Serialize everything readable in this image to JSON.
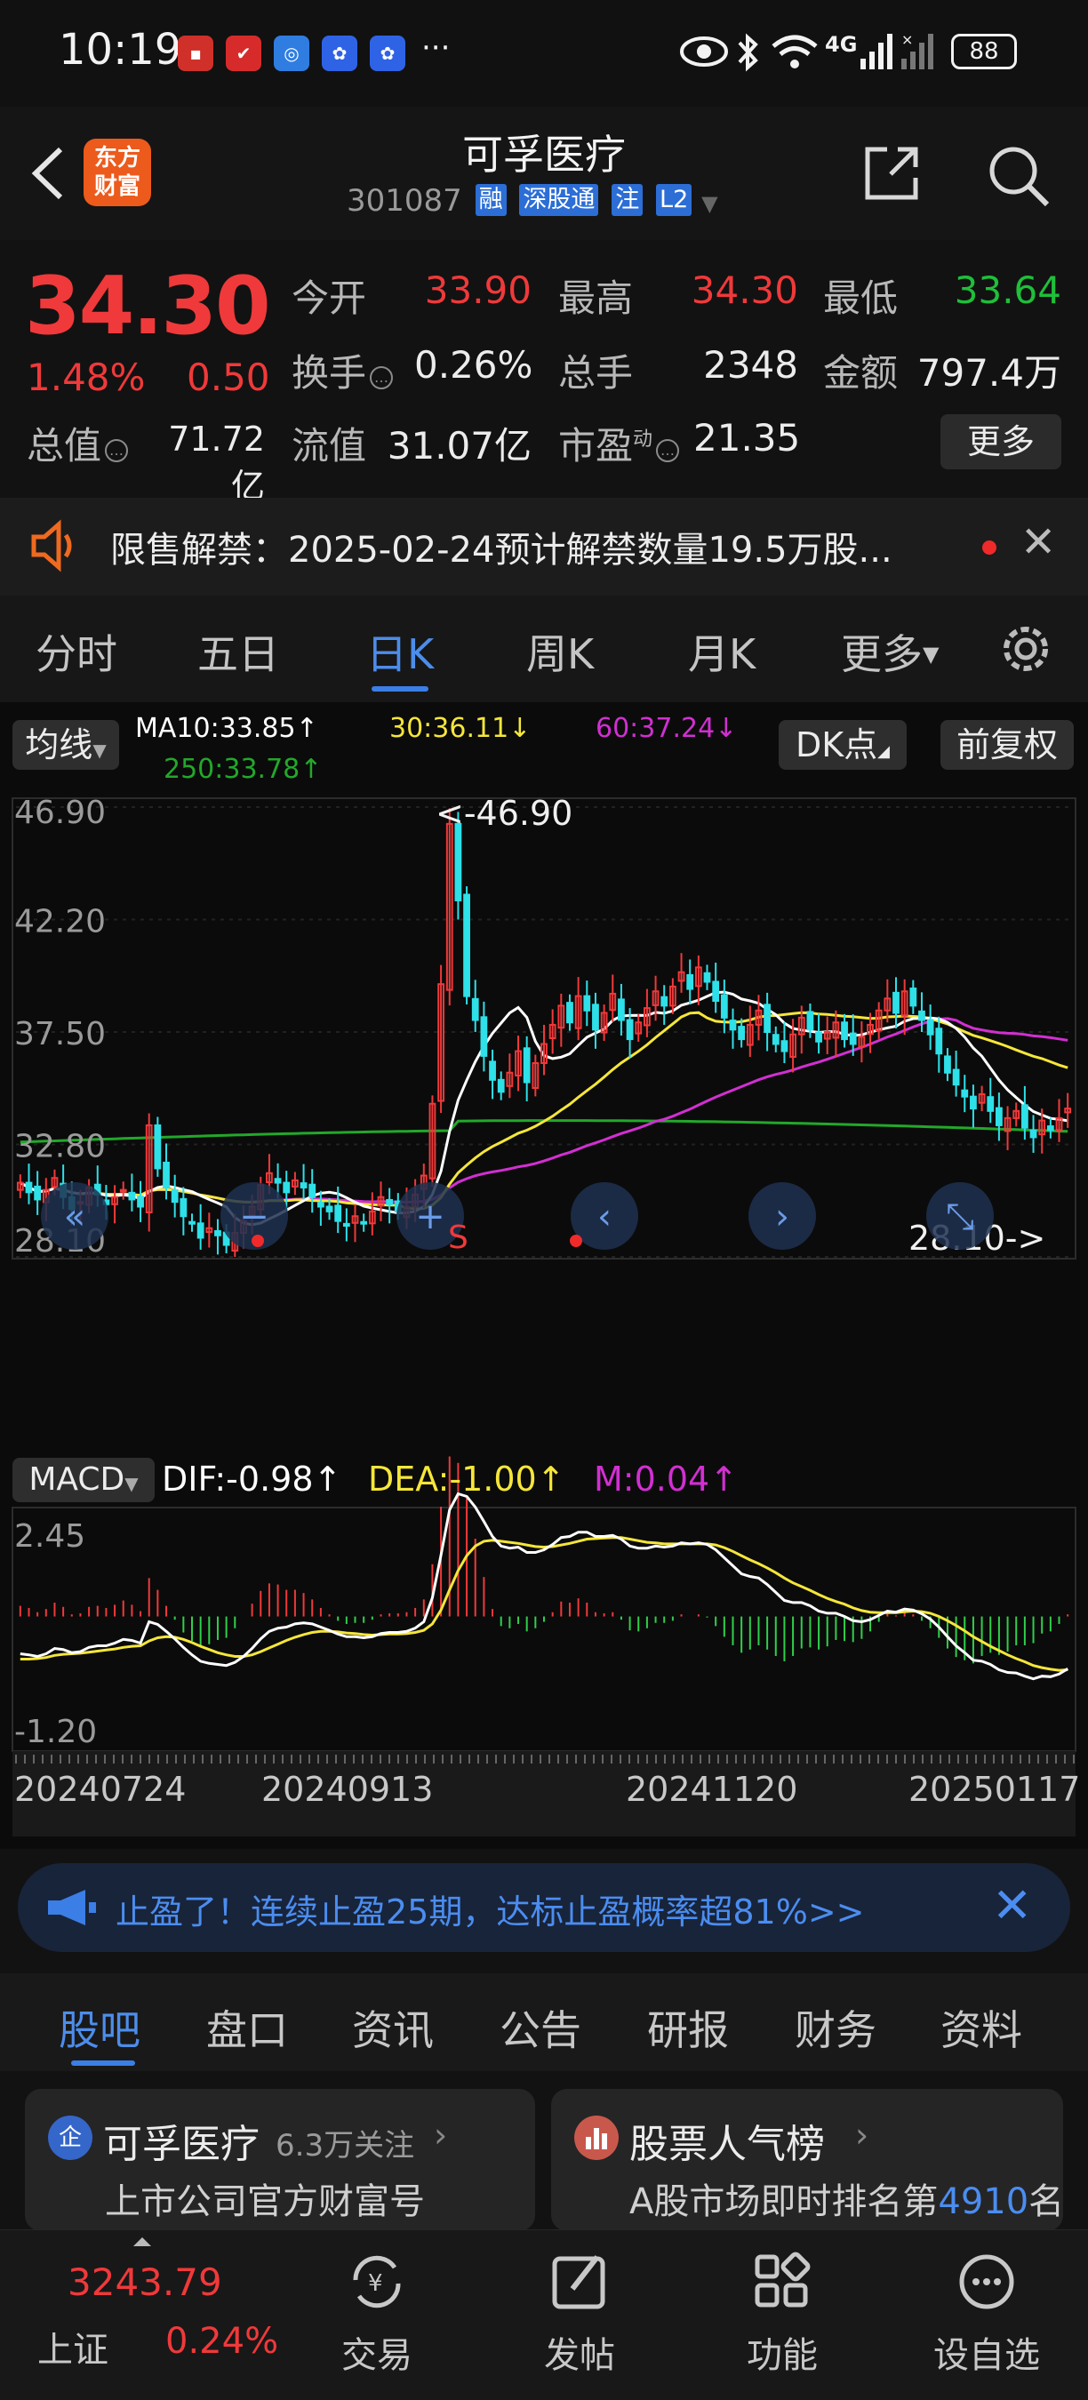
{
  "status_bar": {
    "time": "10:19",
    "network": "4G",
    "battery": "88",
    "more": "···"
  },
  "header": {
    "brand": {
      "line1": "东方",
      "line2": "财富"
    },
    "title": "可孚医疗",
    "code": "301087",
    "tags": [
      "融",
      "深股通",
      "注",
      "L2"
    ]
  },
  "quote": {
    "price": "34.30",
    "change_pct": "1.48%",
    "change_val": "0.50",
    "open_label": "今开",
    "open": "33.90",
    "high_label": "最高",
    "high": "34.30",
    "low_label": "最低",
    "low": "33.64",
    "turnover_label": "换手",
    "turnover": "0.26%",
    "volume_label": "总手",
    "volume": "2348",
    "amount_label": "金额",
    "amount": "797.4万",
    "mktcap_label": "总值",
    "mktcap": "71.72亿",
    "float_label": "流值",
    "float_cap": "31.07亿",
    "pe_label": "市盈",
    "pe_sup": "动",
    "pe": "21.35",
    "more_label": "更多"
  },
  "notice": {
    "text": "限售解禁：2025-02-24预计解禁数量19.5万股..."
  },
  "period_tabs": [
    "分时",
    "五日",
    "日K",
    "周K",
    "月K",
    "更多"
  ],
  "chart": {
    "ma_label": "均线",
    "ma10": "MA10:33.85↑",
    "ma30": "30:36.11↓",
    "ma60": "60:37.24↓",
    "ma250": "250:33.78↑",
    "dk_label": "DK点",
    "adjust_label": "前复权",
    "high_marker": "<-46.90",
    "low_marker": "28.10->",
    "signal_s": "S",
    "macd_label": "MACD",
    "dif": "DIF:-0.98↑",
    "dea": "DEA:-1.00↑",
    "m": "M:0.04↑",
    "colors": {
      "ma10": "#ffffff",
      "ma30": "#f5e63a",
      "ma60": "#d22fd2",
      "ma250": "#22a82a",
      "up": "#f0393a",
      "down": "#2ee0e8"
    }
  },
  "chart_data": [
    {
      "type": "candlestick",
      "title": "",
      "xlabel": "",
      "ylabel": "",
      "y_ticks": [
        46.9,
        42.2,
        37.5,
        32.8,
        28.1
      ],
      "ylim": [
        28.1,
        46.9
      ],
      "x_ticks": [
        "20240724",
        "20240913",
        "20241120",
        "20250117"
      ],
      "annotations": [
        "<-46.90",
        "28.10->"
      ],
      "series": [
        {
          "name": "MA10",
          "last": 33.85
        },
        {
          "name": "MA30",
          "last": 36.11
        },
        {
          "name": "MA60",
          "last": 37.24
        },
        {
          "name": "MA250",
          "last": 33.78
        }
      ],
      "close": [
        31.2,
        30.8,
        30.5,
        30.9,
        31.4,
        30.6,
        30.1,
        30.4,
        31.0,
        30.7,
        30.3,
        30.6,
        30.9,
        30.5,
        30.2,
        33.6,
        31.8,
        31.0,
        30.4,
        29.8,
        29.5,
        28.9,
        29.3,
        29.0,
        28.6,
        29.1,
        29.6,
        30.2,
        31.1,
        31.6,
        31.2,
        30.8,
        31.3,
        31.0,
        30.6,
        30.2,
        30.0,
        29.6,
        29.4,
        29.8,
        29.5,
        30.0,
        30.6,
        30.3,
        30.0,
        30.2,
        30.7,
        31.5,
        34.5,
        39.5,
        46.2,
        43.0,
        39.0,
        38.0,
        36.5,
        35.5,
        35.0,
        35.8,
        36.7,
        35.4,
        36.2,
        37.0,
        37.8,
        38.6,
        37.9,
        39.0,
        38.4,
        37.6,
        38.3,
        39.1,
        38.0,
        37.2,
        37.9,
        38.5,
        39.2,
        38.6,
        39.4,
        40.0,
        39.3,
        40.2,
        39.6,
        38.8,
        38.1,
        37.6,
        37.2,
        37.8,
        38.4,
        37.5,
        37.0,
        36.7,
        37.4,
        38.1,
        37.6,
        37.1,
        37.5,
        37.9,
        37.2,
        37.0,
        37.3,
        37.8,
        38.4,
        38.9,
        38.3,
        39.2,
        38.6,
        38.0,
        37.4,
        36.6,
        35.8,
        35.3,
        34.8,
        34.3,
        34.9,
        34.2,
        33.6,
        33.9,
        34.2,
        33.5,
        33.1,
        33.8,
        33.4,
        33.9,
        34.3
      ]
    },
    {
      "type": "bar",
      "title": "",
      "xlabel": "",
      "ylabel": "",
      "y_ticks": [
        2.45,
        -1.2
      ],
      "ylim": [
        -1.2,
        2.45
      ],
      "series": [
        {
          "name": "DIF",
          "last": -0.98
        },
        {
          "name": "DEA",
          "last": -1.0
        },
        {
          "name": "M",
          "last": 0.04
        }
      ],
      "macd_dif": [
        -0.7,
        -0.72,
        -0.75,
        -0.7,
        -0.6,
        -0.62,
        -0.68,
        -0.66,
        -0.58,
        -0.55,
        -0.55,
        -0.5,
        -0.43,
        -0.45,
        -0.5,
        -0.1,
        -0.15,
        -0.28,
        -0.42,
        -0.58,
        -0.72,
        -0.84,
        -0.88,
        -0.9,
        -0.92,
        -0.86,
        -0.75,
        -0.6,
        -0.42,
        -0.28,
        -0.22,
        -0.2,
        -0.14,
        -0.12,
        -0.14,
        -0.2,
        -0.26,
        -0.33,
        -0.38,
        -0.38,
        -0.4,
        -0.38,
        -0.32,
        -0.3,
        -0.3,
        -0.28,
        -0.22,
        -0.1,
        0.35,
        1.15,
        2.0,
        2.3,
        2.25,
        2.05,
        1.78,
        1.5,
        1.32,
        1.28,
        1.3,
        1.2,
        1.2,
        1.25,
        1.35,
        1.48,
        1.5,
        1.58,
        1.58,
        1.5,
        1.5,
        1.52,
        1.45,
        1.32,
        1.28,
        1.28,
        1.32,
        1.3,
        1.32,
        1.38,
        1.36,
        1.38,
        1.35,
        1.25,
        1.1,
        0.95,
        0.8,
        0.75,
        0.72,
        0.6,
        0.45,
        0.3,
        0.26,
        0.26,
        0.2,
        0.1,
        0.06,
        0.06,
        0.0,
        -0.08,
        -0.1,
        -0.06,
        0.02,
        0.1,
        0.08,
        0.14,
        0.12,
        0.05,
        -0.05,
        -0.2,
        -0.38,
        -0.55,
        -0.68,
        -0.82,
        -0.84,
        -0.9,
        -1.0,
        -1.05,
        -1.06,
        -1.12,
        -1.17,
        -1.12,
        -1.13,
        -1.08,
        -0.98
      ],
      "macd_dea": [
        -0.8,
        -0.8,
        -0.79,
        -0.77,
        -0.73,
        -0.71,
        -0.7,
        -0.69,
        -0.67,
        -0.65,
        -0.63,
        -0.61,
        -0.58,
        -0.56,
        -0.55,
        -0.46,
        -0.4,
        -0.38,
        -0.39,
        -0.43,
        -0.49,
        -0.56,
        -0.62,
        -0.68,
        -0.72,
        -0.75,
        -0.75,
        -0.72,
        -0.66,
        -0.59,
        -0.52,
        -0.45,
        -0.39,
        -0.34,
        -0.3,
        -0.28,
        -0.28,
        -0.29,
        -0.31,
        -0.32,
        -0.34,
        -0.35,
        -0.34,
        -0.33,
        -0.33,
        -0.32,
        -0.3,
        -0.26,
        -0.14,
        0.12,
        0.5,
        0.86,
        1.14,
        1.32,
        1.41,
        1.43,
        1.41,
        1.39,
        1.37,
        1.34,
        1.31,
        1.3,
        1.31,
        1.34,
        1.37,
        1.41,
        1.45,
        1.46,
        1.47,
        1.48,
        1.48,
        1.45,
        1.42,
        1.39,
        1.38,
        1.36,
        1.36,
        1.36,
        1.36,
        1.36,
        1.36,
        1.34,
        1.29,
        1.22,
        1.14,
        1.06,
        0.99,
        0.91,
        0.82,
        0.72,
        0.63,
        0.56,
        0.49,
        0.41,
        0.34,
        0.28,
        0.23,
        0.16,
        0.11,
        0.08,
        0.07,
        0.07,
        0.07,
        0.09,
        0.1,
        0.09,
        0.06,
        0.0,
        -0.08,
        -0.17,
        -0.27,
        -0.38,
        -0.47,
        -0.56,
        -0.64,
        -0.72,
        -0.79,
        -0.85,
        -0.92,
        -0.96,
        -0.99,
        -1.01,
        -1.0
      ]
    }
  ],
  "promo": {
    "text": "止盈了！连续止盈25期，达标止盈概率超81%>>"
  },
  "info_tabs": [
    "股吧",
    "盘口",
    "资讯",
    "公告",
    "研报",
    "财务",
    "资料"
  ],
  "cards": {
    "left": {
      "badge": "企",
      "title": "可孚医疗",
      "followers": "6.3万关注",
      "subtitle": "上市公司官方财富号"
    },
    "right": {
      "title": "股票人气榜",
      "subtitle_pre": "A股市场即时排名第",
      "rank": "4910",
      "subtitle_post": "名"
    }
  },
  "bottom_nav": {
    "index_value": "3243.79",
    "index_name": "上证",
    "index_change": "0.24%",
    "items": [
      "交易",
      "发帖",
      "功能",
      "设自选"
    ]
  }
}
